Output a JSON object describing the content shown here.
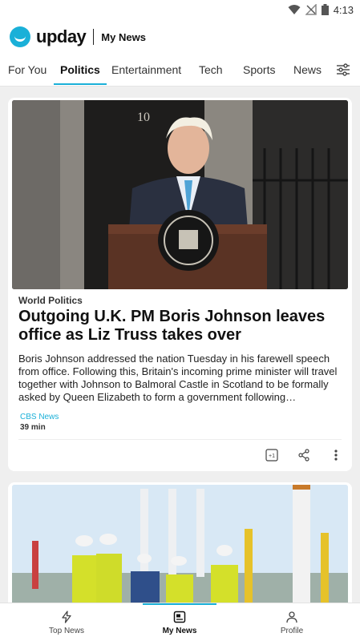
{
  "status_bar": {
    "time": "4:13"
  },
  "header": {
    "logo": "upday",
    "title": "My News"
  },
  "tabs": [
    {
      "label": "For You",
      "active": false
    },
    {
      "label": "Politics",
      "active": true
    },
    {
      "label": "Entertainment",
      "active": false
    },
    {
      "label": "Tech",
      "active": false
    },
    {
      "label": "Sports",
      "active": false
    },
    {
      "label": "News",
      "active": false
    }
  ],
  "articles": [
    {
      "category": "World Politics",
      "headline": "Outgoing U.K. PM Boris Johnson leaves office as Liz Truss takes over",
      "summary": "Boris Johnson addressed the nation Tuesday in his farewell speech from office. Following this, Britain's incoming prime minister will travel together with Johnson to Balmoral Castle in Scotland to be formally asked by Queen Elizabeth to form a government following…",
      "source": "CBS News",
      "time": "39 min",
      "door_number": "10",
      "plus_one": "+1"
    }
  ],
  "bottom_nav": [
    {
      "label": "Top News",
      "icon": "bolt-icon",
      "active": false
    },
    {
      "label": "My News",
      "icon": "newspaper-icon",
      "active": true
    },
    {
      "label": "Profile",
      "icon": "person-icon",
      "active": false
    }
  ],
  "colors": {
    "accent": "#1ab0d8"
  }
}
